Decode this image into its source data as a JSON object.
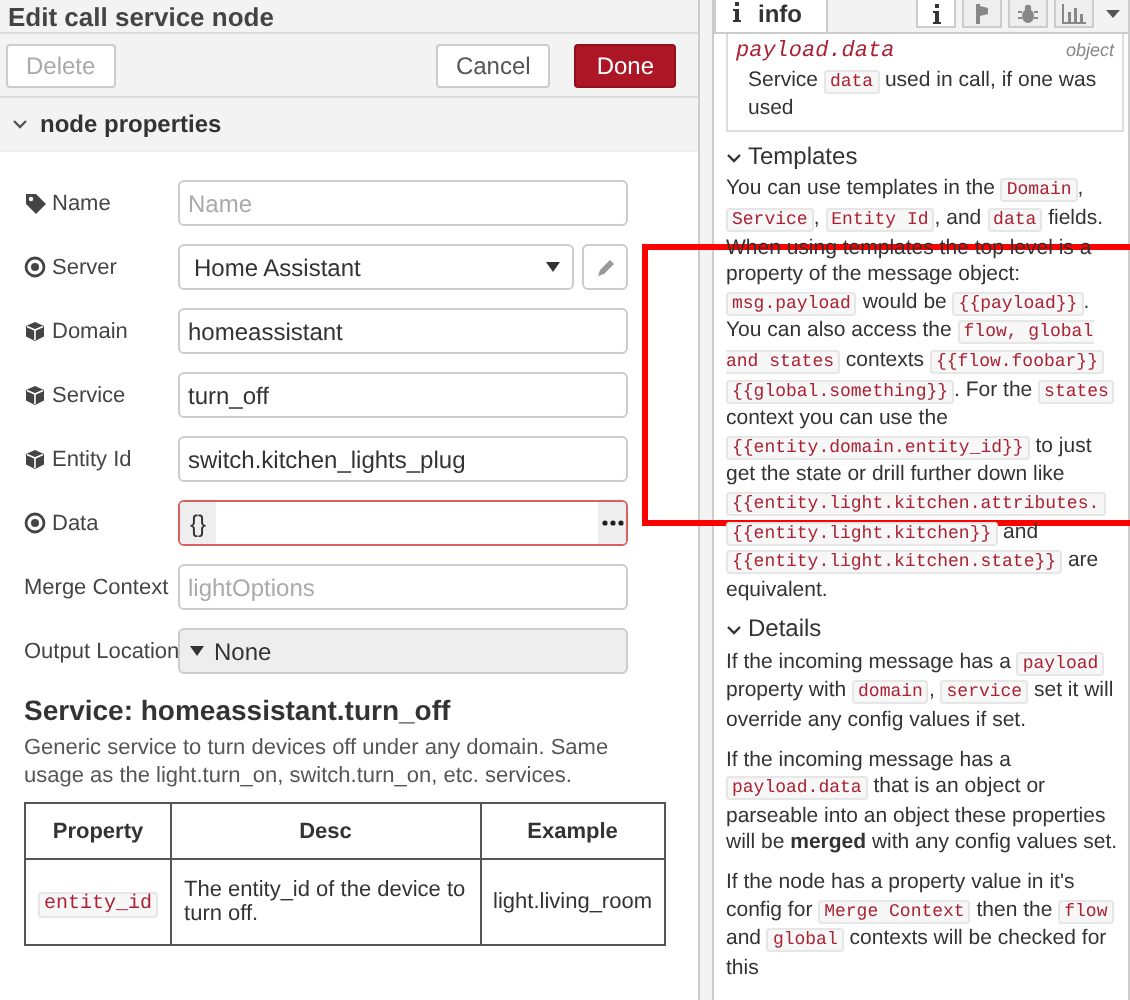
{
  "editor": {
    "title": "Edit call service node",
    "buttons": [
      {
        "label": "Delete",
        "kind": "secondary",
        "disabled": true
      },
      {
        "label": "Cancel",
        "kind": "secondary",
        "disabled": false
      },
      {
        "label": "Done",
        "kind": "primary",
        "disabled": false
      }
    ],
    "section": {
      "label": "node properties",
      "expanded": true
    },
    "fields": [
      {
        "kind": "name",
        "label": "Name",
        "placeholder": "Name"
      },
      {
        "kind": "server",
        "label": "Server",
        "value": "Home Assistant"
      },
      {
        "kind": "entity",
        "label": "Domain",
        "value": "homeassistant"
      },
      {
        "kind": "entity",
        "label": "Service",
        "value": "turn_off"
      },
      {
        "kind": "entity",
        "label": "Entity Id",
        "value": "switch.kitchen_lights_plug"
      },
      {
        "kind": "data",
        "label": "Data",
        "value": "{}",
        "error": true
      },
      {
        "kind": "plain",
        "label": "Merge Context",
        "placeholder": "lightOptions"
      },
      {
        "kind": "menu",
        "label": "Output Location",
        "value": "None"
      }
    ],
    "service": {
      "title": "Service: homeassistant.turn_off",
      "description": "Generic service to turn devices off under any domain. Same usage as the light.turn_on, switch.turn_on, etc. services.",
      "table": {
        "columns": [
          "Property",
          "Desc",
          "Example"
        ],
        "rows": [
          [
            "entity_id",
            "The entity_id of the device to turn off.",
            "light.living_room"
          ]
        ]
      }
    }
  },
  "sidebar": {
    "tab": {
      "label": "info"
    },
    "tab_buttons": [
      {
        "kind": "info",
        "selected": true
      },
      {
        "kind": "help",
        "selected": false
      },
      {
        "kind": "debug",
        "selected": false
      },
      {
        "kind": "chart",
        "selected": false
      }
    ],
    "property": {
      "name": "payload.data",
      "type": "object",
      "description": [
        {
          "kind": "text",
          "text": "Service "
        },
        {
          "kind": "code",
          "text": "data"
        },
        {
          "kind": "text",
          "text": " used in call, if one was used"
        }
      ]
    },
    "sections": [
      {
        "title": "Templates",
        "expanded": true,
        "paragraphs": [
          [
            {
              "kind": "text",
              "text": "You can use templates in the "
            },
            {
              "kind": "code",
              "text": "Domain"
            },
            {
              "kind": "text",
              "text": ", "
            },
            {
              "kind": "code",
              "text": "Service"
            },
            {
              "kind": "text",
              "text": ", "
            },
            {
              "kind": "code",
              "text": "Entity Id"
            },
            {
              "kind": "text",
              "text": ", and "
            },
            {
              "kind": "code",
              "text": "data"
            },
            {
              "kind": "text",
              "text": " fields. When using templates the top level is a property of the message object: "
            },
            {
              "kind": "code",
              "text": "msg.payload"
            },
            {
              "kind": "text",
              "text": " would be "
            },
            {
              "kind": "code",
              "text": "{{payload}}"
            },
            {
              "kind": "text",
              "text": ". You can also access the "
            },
            {
              "kind": "code",
              "text": "flow, global and states"
            },
            {
              "kind": "text",
              "text": " contexts "
            },
            {
              "kind": "code",
              "text": "{{flow.foobar}}"
            },
            {
              "kind": "code",
              "text": "{{global.something}}"
            },
            {
              "kind": "text",
              "text": ". For the "
            },
            {
              "kind": "code",
              "text": "states"
            },
            {
              "kind": "text",
              "text": " context you can use the "
            },
            {
              "kind": "code",
              "text": "{{entity.domain.entity_id}}"
            },
            {
              "kind": "text",
              "text": " to just get the state or drill further down like "
            },
            {
              "kind": "code",
              "text": "{{entity.light.kitchen.attributes."
            },
            {
              "kind": "code",
              "text": "{{entity.light.kitchen}}"
            },
            {
              "kind": "text",
              "text": " and "
            },
            {
              "kind": "code",
              "text": "{{entity.light.kitchen.state}}"
            },
            {
              "kind": "text",
              "text": " are equivalent."
            }
          ]
        ]
      },
      {
        "title": "Details",
        "expanded": true,
        "paragraphs": [
          [
            {
              "kind": "text",
              "text": "If the incoming message has a "
            },
            {
              "kind": "code",
              "text": "payload"
            },
            {
              "kind": "text",
              "text": " property with "
            },
            {
              "kind": "code",
              "text": "domain"
            },
            {
              "kind": "text",
              "text": ", "
            },
            {
              "kind": "code",
              "text": "service"
            },
            {
              "kind": "text",
              "text": " set it will override any config values if set."
            }
          ],
          [
            {
              "kind": "text",
              "text": "If the incoming message has a "
            },
            {
              "kind": "code",
              "text": "payload.data"
            },
            {
              "kind": "text",
              "text": " that is an object or parseable into an object these properties will be "
            },
            {
              "kind": "bold",
              "text": "merged"
            },
            {
              "kind": "text",
              "text": " with any config values set."
            }
          ],
          [
            {
              "kind": "text",
              "text": "If the node has a property value in it's config for "
            },
            {
              "kind": "code",
              "text": "Merge Context"
            },
            {
              "kind": "text",
              "text": " then the "
            },
            {
              "kind": "code",
              "text": "flow"
            },
            {
              "kind": "text",
              "text": " and "
            },
            {
              "kind": "code",
              "text": "global"
            },
            {
              "kind": "text",
              "text": " contexts will be checked for this"
            }
          ]
        ]
      }
    ]
  },
  "annotation": {
    "kind": "rectangle",
    "color": "#ff0000"
  }
}
